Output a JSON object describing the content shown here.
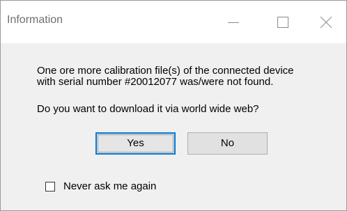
{
  "window": {
    "title": "Information"
  },
  "message": {
    "line1": "One ore more calibration file(s) of the connected device",
    "line2": "with serial number #20012077 was/were not found.",
    "question": "Do you want to download it via world wide web?"
  },
  "buttons": {
    "yes_label": "Yes",
    "no_label": "No",
    "default": "yes"
  },
  "options": {
    "never_ask_label": "Never ask me again",
    "never_ask_checked": false
  },
  "icons": {
    "minimize": "minimize-icon",
    "maximize": "maximize-icon",
    "close": "close-icon"
  },
  "colors": {
    "titlebar_bg": "#ffffff",
    "dialog_bg": "#f0f0f0",
    "default_button_border": "#0078d7",
    "button_bg": "#e1e1e1"
  }
}
